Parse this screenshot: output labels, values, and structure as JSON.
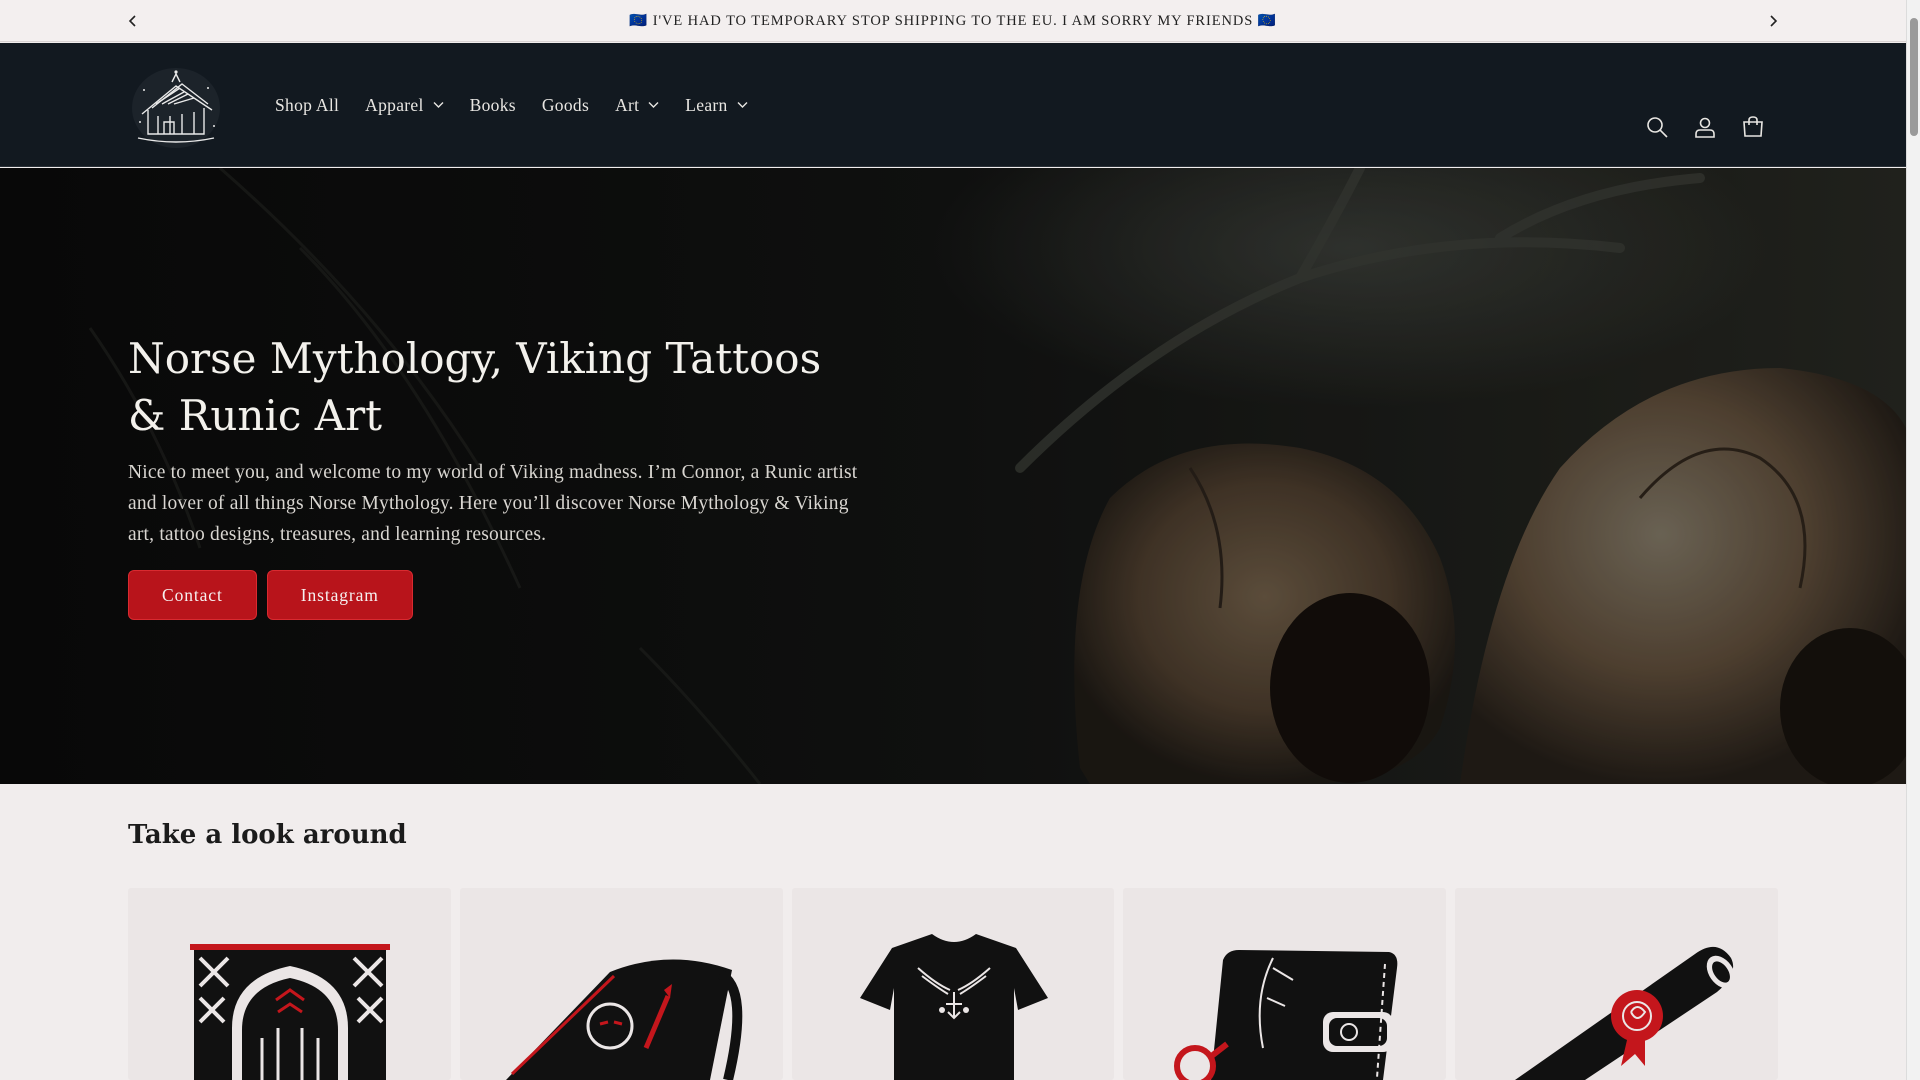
{
  "announcement": {
    "text": "🇪🇺 I'VE HAD TO TEMPORARY STOP SHIPPING TO THE EU. I AM SORRY MY FRIENDS 🇪🇺",
    "prev_icon": "chevron-left-icon",
    "next_icon": "chevron-right-icon"
  },
  "header": {
    "logo_icon": "viking-longhouse-logo",
    "nav": [
      {
        "label": "Shop All",
        "has_dropdown": false
      },
      {
        "label": "Apparel",
        "has_dropdown": true
      },
      {
        "label": "Books",
        "has_dropdown": false
      },
      {
        "label": "Goods",
        "has_dropdown": false
      },
      {
        "label": "Art",
        "has_dropdown": true
      },
      {
        "label": "Learn",
        "has_dropdown": true
      }
    ],
    "icons": [
      "search-icon",
      "account-icon",
      "cart-icon"
    ]
  },
  "hero": {
    "title": "Norse Mythology, Viking Tattoos & Runic Art",
    "text": "Nice to meet you, and welcome to my world of Viking madness. I’m Connor, a Runic artist and lover of all things Norse Mythology. Here you’ll discover Norse Mythology & Viking art, tattoo designs, treasures, and learning resources.",
    "buttons": {
      "contact": "Contact",
      "instagram": "Instagram"
    }
  },
  "collections": {
    "title": "Take a look around",
    "cards": [
      {
        "icon": "runic-banner-icon"
      },
      {
        "icon": "book-icon"
      },
      {
        "icon": "tshirt-icon"
      },
      {
        "icon": "wallet-icon"
      },
      {
        "icon": "scroll-icon"
      }
    ]
  },
  "colors": {
    "accent": "#b8141b",
    "header_bg": "#121920",
    "page_bg": "#f1eded"
  }
}
